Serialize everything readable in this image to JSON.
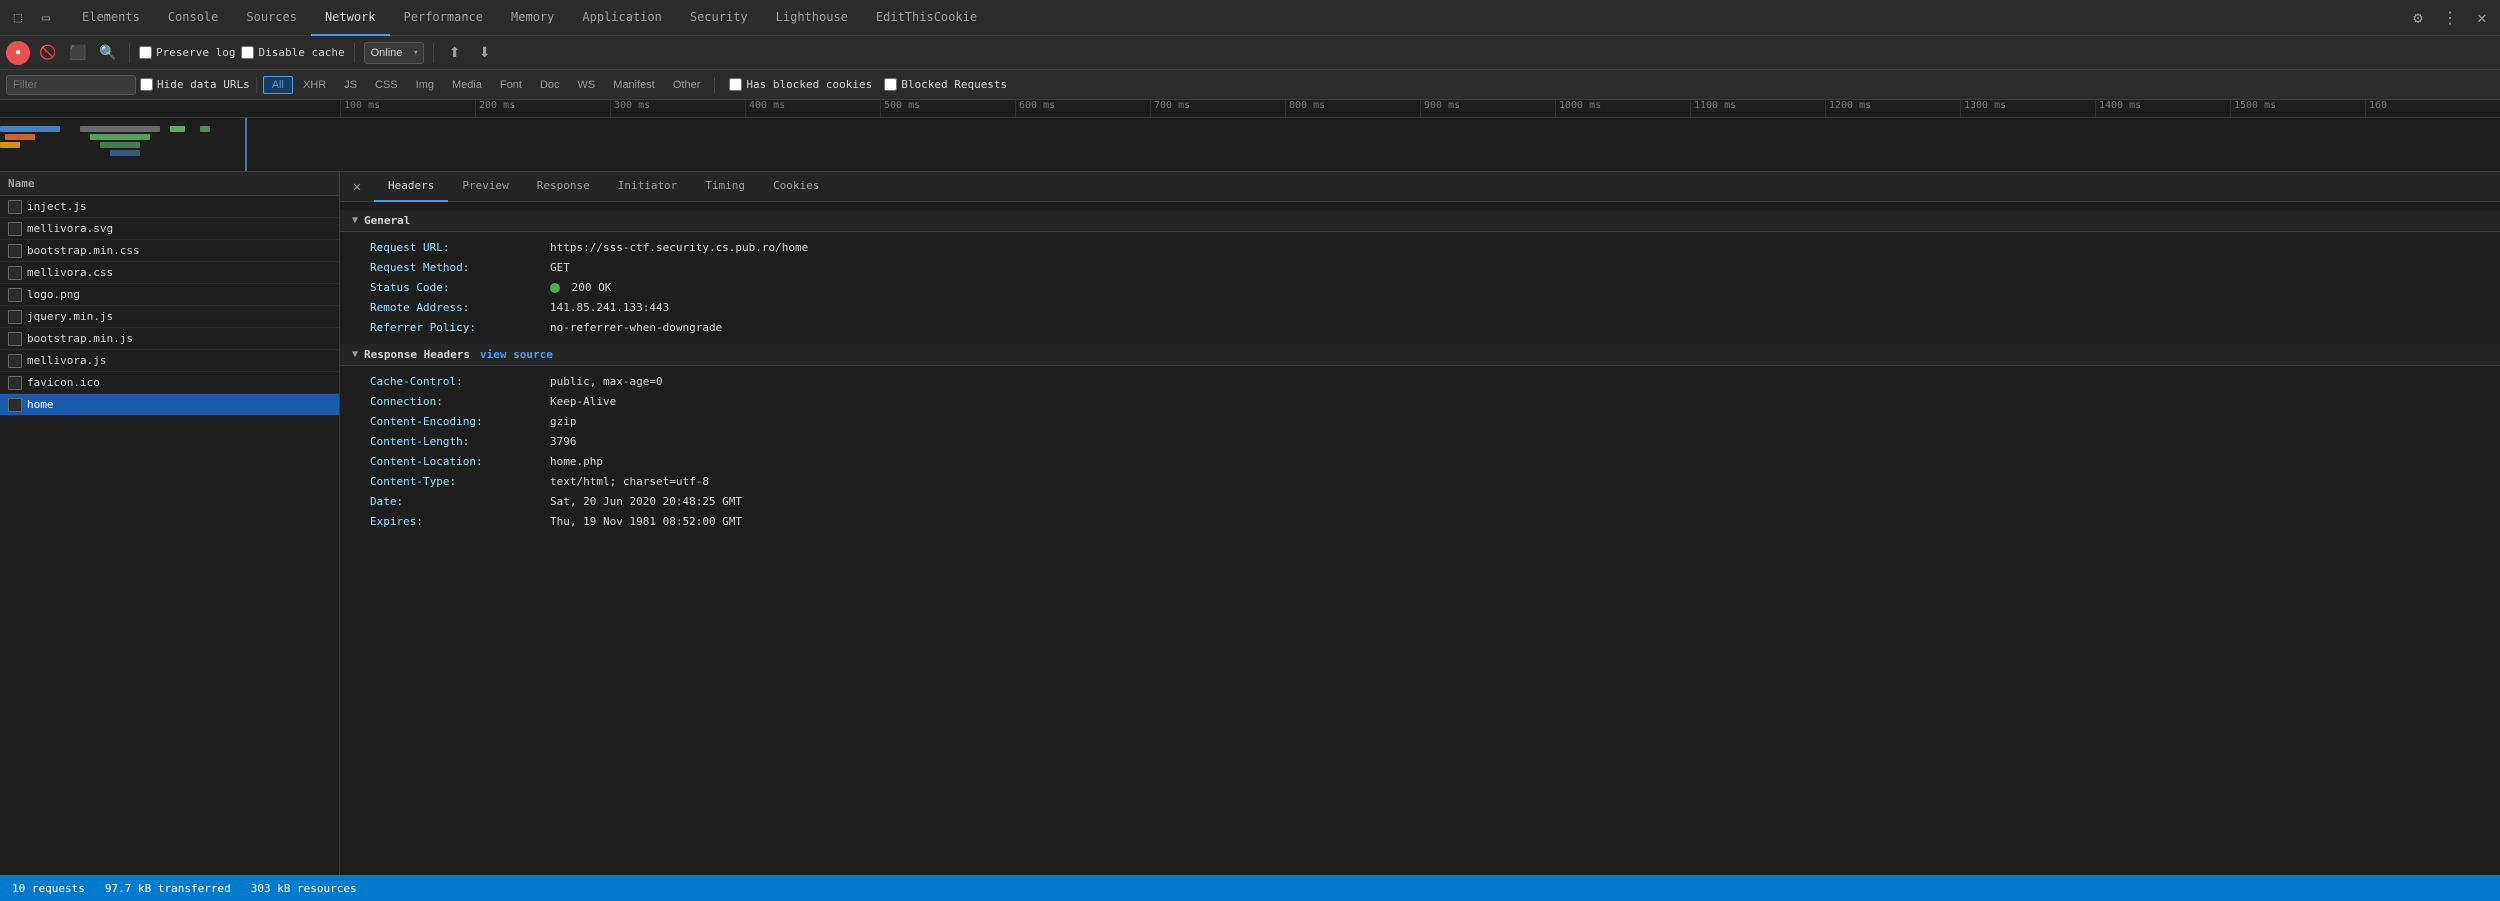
{
  "tabs": {
    "items": [
      {
        "id": "elements",
        "label": "Elements",
        "active": false
      },
      {
        "id": "console",
        "label": "Console",
        "active": false
      },
      {
        "id": "sources",
        "label": "Sources",
        "active": false
      },
      {
        "id": "network",
        "label": "Network",
        "active": true
      },
      {
        "id": "performance",
        "label": "Performance",
        "active": false
      },
      {
        "id": "memory",
        "label": "Memory",
        "active": false
      },
      {
        "id": "application",
        "label": "Application",
        "active": false
      },
      {
        "id": "security",
        "label": "Security",
        "active": false
      },
      {
        "id": "lighthouse",
        "label": "Lighthouse",
        "active": false
      },
      {
        "id": "editthiscookie",
        "label": "EditThisCookie",
        "active": false
      }
    ]
  },
  "toolbar": {
    "preserve_log_label": "Preserve log",
    "disable_cache_label": "Disable cache",
    "throttle_value": "Online",
    "record_label": "Stop recording network log",
    "clear_label": "Clear"
  },
  "filter_bar": {
    "placeholder": "Filter",
    "hide_data_urls_label": "Hide data URLs",
    "tags": [
      "All",
      "XHR",
      "JS",
      "CSS",
      "Img",
      "Media",
      "Font",
      "Doc",
      "WS",
      "Manifest",
      "Other"
    ],
    "active_tag": "All",
    "has_blocked_cookies_label": "Has blocked cookies",
    "blocked_requests_label": "Blocked Requests"
  },
  "timeline": {
    "markers": [
      "100 ms",
      "200 ms",
      "300 ms",
      "400 ms",
      "500 ms",
      "600 ms",
      "700 ms",
      "800 ms",
      "900 ms",
      "1000 ms",
      "1100 ms",
      "1200 ms",
      "1300 ms",
      "1400 ms",
      "1500 ms",
      "160"
    ]
  },
  "file_list": {
    "header": "Name",
    "items": [
      {
        "name": "inject.js",
        "selected": false
      },
      {
        "name": "mellivora.svg",
        "selected": false
      },
      {
        "name": "bootstrap.min.css",
        "selected": false
      },
      {
        "name": "mellivora.css",
        "selected": false
      },
      {
        "name": "logo.png",
        "selected": false
      },
      {
        "name": "jquery.min.js",
        "selected": false
      },
      {
        "name": "bootstrap.min.js",
        "selected": false
      },
      {
        "name": "mellivora.js",
        "selected": false
      },
      {
        "name": "favicon.ico",
        "selected": false
      },
      {
        "name": "home",
        "selected": true
      }
    ]
  },
  "sub_tabs": {
    "items": [
      {
        "id": "headers",
        "label": "Headers",
        "active": true
      },
      {
        "id": "preview",
        "label": "Preview",
        "active": false
      },
      {
        "id": "response",
        "label": "Response",
        "active": false
      },
      {
        "id": "initiator",
        "label": "Initiator",
        "active": false
      },
      {
        "id": "timing",
        "label": "Timing",
        "active": false
      },
      {
        "id": "cookies",
        "label": "Cookies",
        "active": false
      }
    ]
  },
  "headers": {
    "general_section": "General",
    "response_headers_section": "Response Headers",
    "view_source_label": "view source",
    "general": {
      "request_url_key": "Request URL:",
      "request_url_value": "https://sss-ctf.security.cs.pub.ro/home",
      "request_method_key": "Request Method:",
      "request_method_value": "GET",
      "status_code_key": "Status Code:",
      "status_code_value": "200  OK",
      "remote_address_key": "Remote Address:",
      "remote_address_value": "141.85.241.133:443",
      "referrer_policy_key": "Referrer Policy:",
      "referrer_policy_value": "no-referrer-when-downgrade"
    },
    "response": [
      {
        "key": "Cache-Control:",
        "value": "public, max-age=0"
      },
      {
        "key": "Connection:",
        "value": "Keep-Alive"
      },
      {
        "key": "Content-Encoding:",
        "value": "gzip"
      },
      {
        "key": "Content-Length:",
        "value": "3796"
      },
      {
        "key": "Content-Location:",
        "value": "home.php"
      },
      {
        "key": "Content-Type:",
        "value": "text/html; charset=utf-8"
      },
      {
        "key": "Date:",
        "value": "Sat, 20 Jun 2020 20:48:25 GMT"
      },
      {
        "key": "Expires:",
        "value": "Thu, 19 Nov 1981 08:52:00 GMT"
      }
    ]
  },
  "status_bar": {
    "requests": "10 requests",
    "transferred": "97.7 kB transferred",
    "resources": "303 kB resources"
  }
}
